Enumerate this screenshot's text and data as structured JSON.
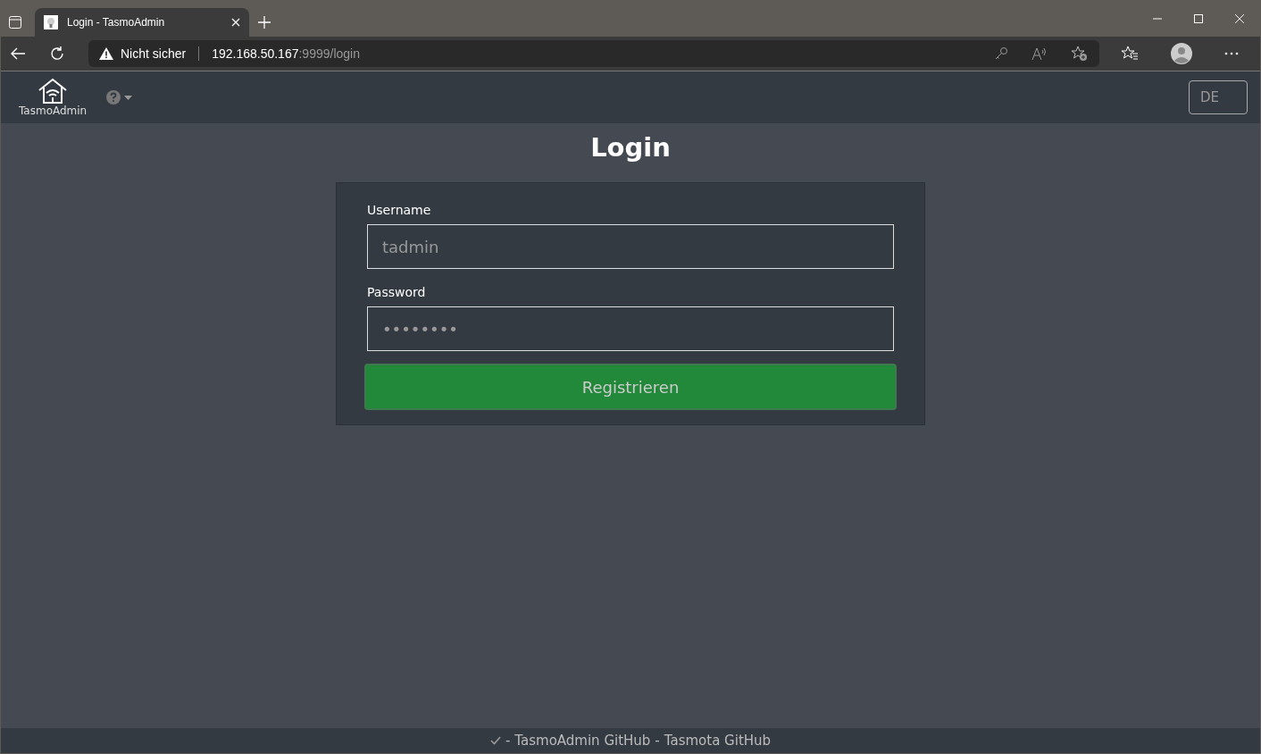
{
  "browser": {
    "tab": {
      "title": "Login - TasmoAdmin",
      "selected": true
    },
    "security": "Nicht sicher",
    "url_host": "192.168.50.167",
    "url_rest": ":9999/login"
  },
  "navbar": {
    "brand": "TasmoAdmin",
    "language": "DE"
  },
  "title": "Login",
  "form": {
    "fields": [
      {
        "label": "Username",
        "value": "tadmin"
      },
      {
        "label": "Password",
        "value": "••••••••"
      }
    ],
    "submit": "Registrieren"
  },
  "footer": {
    "items": [
      {
        "separator": "-",
        "link": "TasmoAdmin GitHub"
      },
      {
        "separator": "-",
        "link": "Tasmota GitHub"
      }
    ]
  }
}
